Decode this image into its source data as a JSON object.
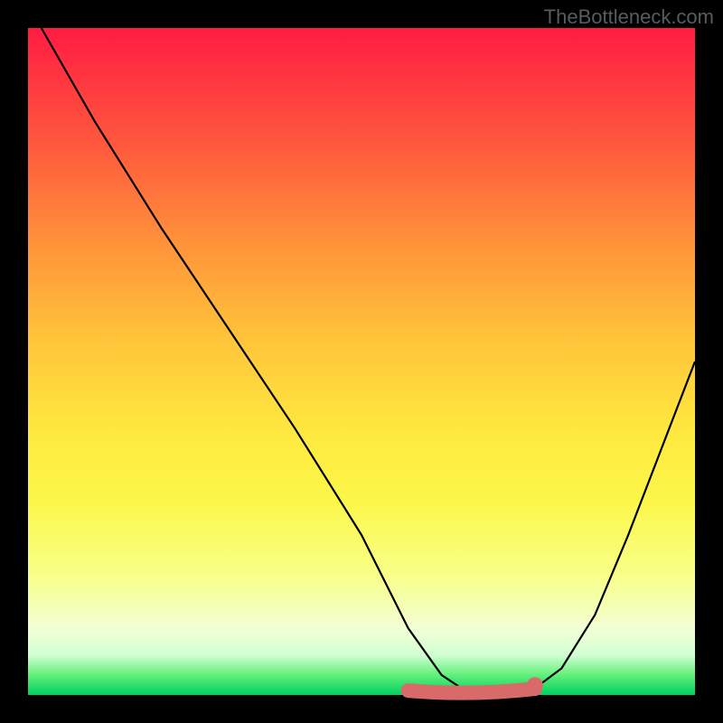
{
  "watermark": "TheBottleneck.com",
  "chart_data": {
    "type": "line",
    "title": "",
    "xlabel": "",
    "ylabel": "",
    "xlim": [
      0,
      100
    ],
    "ylim": [
      0,
      100
    ],
    "grid": false,
    "legend": false,
    "series": [
      {
        "name": "curve",
        "x": [
          2,
          10,
          20,
          30,
          40,
          50,
          57,
          62,
          65,
          70,
          76,
          80,
          85,
          90,
          95,
          100
        ],
        "y": [
          100,
          86,
          70,
          55,
          40,
          24,
          10,
          3,
          1,
          0.5,
          1,
          4,
          12,
          24,
          37,
          50
        ]
      }
    ],
    "annotations": {
      "highlight_band": {
        "x_start": 57,
        "x_end": 76,
        "y": 1.2
      },
      "highlight_dot": {
        "x": 76,
        "y": 1.6
      }
    },
    "colors": {
      "curve": "#000000",
      "highlight": "#d96a6a",
      "gradient_top": "#ff1c42",
      "gradient_mid": "#ffe73f",
      "gradient_bottom": "#00d060"
    }
  }
}
